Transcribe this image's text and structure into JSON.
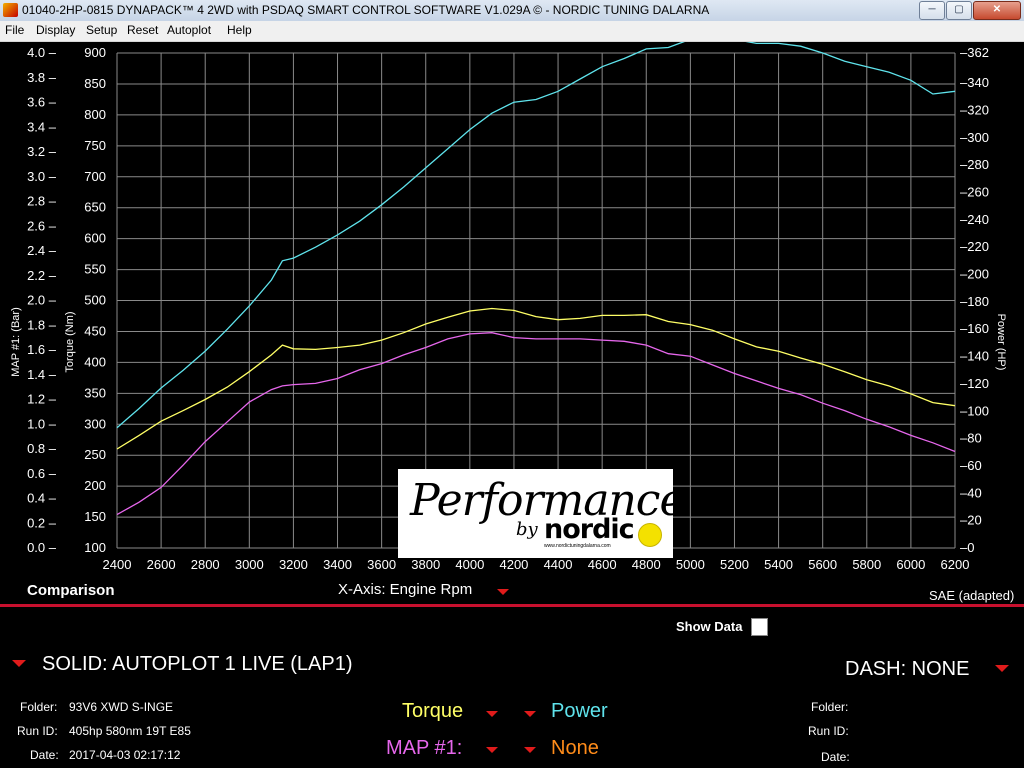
{
  "window": {
    "title": "01040-2HP-0815 DYNAPACK™ 4 2WD with PSDAQ SMART CONTROL SOFTWARE V1.029A © - NORDIC TUNING DALARNA",
    "buttons": {
      "minimize": "─",
      "maximize": "▢",
      "close": "✕"
    }
  },
  "menu": [
    "File",
    "Display",
    "Setup",
    "Reset",
    "Autoplot",
    "Help"
  ],
  "chart_data": {
    "type": "line",
    "x": [
      2400,
      2500,
      2600,
      2700,
      2800,
      2900,
      3000,
      3100,
      3150,
      3200,
      3300,
      3400,
      3500,
      3600,
      3700,
      3800,
      3900,
      4000,
      4100,
      4200,
      4300,
      4400,
      4500,
      4600,
      4700,
      4800,
      4900,
      5000,
      5100,
      5200,
      5300,
      5400,
      5500,
      5600,
      5700,
      5800,
      5900,
      6000,
      6100,
      6200
    ],
    "xticks": [
      2400,
      2600,
      2800,
      3000,
      3200,
      3400,
      3600,
      3800,
      4000,
      4200,
      4400,
      4600,
      4800,
      5000,
      5200,
      5400,
      5600,
      5800,
      6000,
      6200
    ],
    "xlim": [
      2400,
      6200
    ],
    "xlabel": "X-Axis: Engine Rpm",
    "axes": {
      "map": {
        "label": "MAP #1: (Bar)",
        "ticks": [
          "0.0",
          "0.2",
          "0.4",
          "0.6",
          "0.8",
          "1.0",
          "1.2",
          "1.4",
          "1.6",
          "1.8",
          "2.0",
          "2.2",
          "2.4",
          "2.6",
          "2.8",
          "3.0",
          "3.2",
          "3.4",
          "3.6",
          "3.8",
          "4.0"
        ],
        "lim": [
          0.0,
          4.0
        ]
      },
      "torque": {
        "label": "Torque (Nm)",
        "ticks": [
          "100",
          "150",
          "200",
          "250",
          "300",
          "350",
          "400",
          "450",
          "500",
          "550",
          "600",
          "650",
          "700",
          "750",
          "800",
          "850",
          "900"
        ],
        "lim": [
          100,
          900
        ]
      },
      "power": {
        "label": "Power (HP)",
        "ticks": [
          "0",
          "20",
          "40",
          "60",
          "80",
          "100",
          "120",
          "140",
          "160",
          "180",
          "200",
          "220",
          "240",
          "260",
          "280",
          "300",
          "320",
          "340",
          "362"
        ],
        "lim": [
          0,
          362
        ]
      }
    },
    "series": [
      {
        "name": "Torque",
        "axis": "torque",
        "color": "#ffff66",
        "values": [
          260,
          282,
          305,
          322,
          340,
          360,
          385,
          412,
          428,
          422,
          421,
          424,
          428,
          436,
          448,
          462,
          473,
          483,
          487,
          484,
          474,
          469,
          471,
          476,
          476,
          477,
          466,
          461,
          452,
          438,
          425,
          418,
          407,
          397,
          385,
          372,
          362,
          349,
          335,
          330
        ]
      },
      {
        "name": "Power",
        "axis": "power",
        "color": "#5fe3ec",
        "values": [
          88,
          102,
          117,
          130,
          144,
          160,
          177,
          196,
          210,
          212,
          220,
          229,
          239,
          251,
          264,
          278,
          292,
          306,
          318,
          326,
          328,
          334,
          343,
          352,
          358,
          365,
          366,
          372,
          374,
          372,
          369,
          369,
          367,
          362,
          356,
          352,
          348,
          342,
          332,
          334
        ]
      },
      {
        "name": "MAP #1:",
        "axis": "map",
        "color": "#e667ec",
        "values": [
          0.27,
          0.37,
          0.49,
          0.67,
          0.86,
          1.02,
          1.18,
          1.28,
          1.31,
          1.32,
          1.33,
          1.37,
          1.44,
          1.49,
          1.56,
          1.62,
          1.69,
          1.73,
          1.74,
          1.7,
          1.69,
          1.69,
          1.69,
          1.68,
          1.67,
          1.64,
          1.57,
          1.55,
          1.48,
          1.41,
          1.35,
          1.29,
          1.24,
          1.17,
          1.11,
          1.04,
          0.98,
          0.91,
          0.85,
          0.78
        ]
      }
    ],
    "grid": true
  },
  "panel": {
    "comparison_label": "Comparison",
    "xaxis_label": "X-Axis: Engine Rpm",
    "sae_label": "SAE (adapted)",
    "show_data_label": "Show Data",
    "solid_label": "SOLID: AUTOPLOT 1 LIVE (LAP1)",
    "dash_label": "DASH: NONE",
    "left_info": {
      "folder_label": "Folder:",
      "folder_value": "93V6 XWD S-INGE",
      "runid_label": "Run ID:",
      "runid_value": "405hp 580nm 19T E85",
      "date_label": "Date:",
      "date_value": "2017-04-03 02:17:12"
    },
    "right_info": {
      "folder_label": "Folder:",
      "runid_label": "Run ID:",
      "date_label": "Date:"
    },
    "selectors": {
      "torque": "Torque",
      "power": "Power",
      "map": "MAP #1:",
      "none": "None",
      "torque_color": "#ffff66",
      "power_color": "#5fe3ec",
      "map_color": "#e667ec",
      "none_color": "#ff8c1a"
    }
  },
  "logo": {
    "script": "Performance",
    "by": "by",
    "brand": "nordic",
    "url": "www.nordictuningdalarna.com"
  }
}
